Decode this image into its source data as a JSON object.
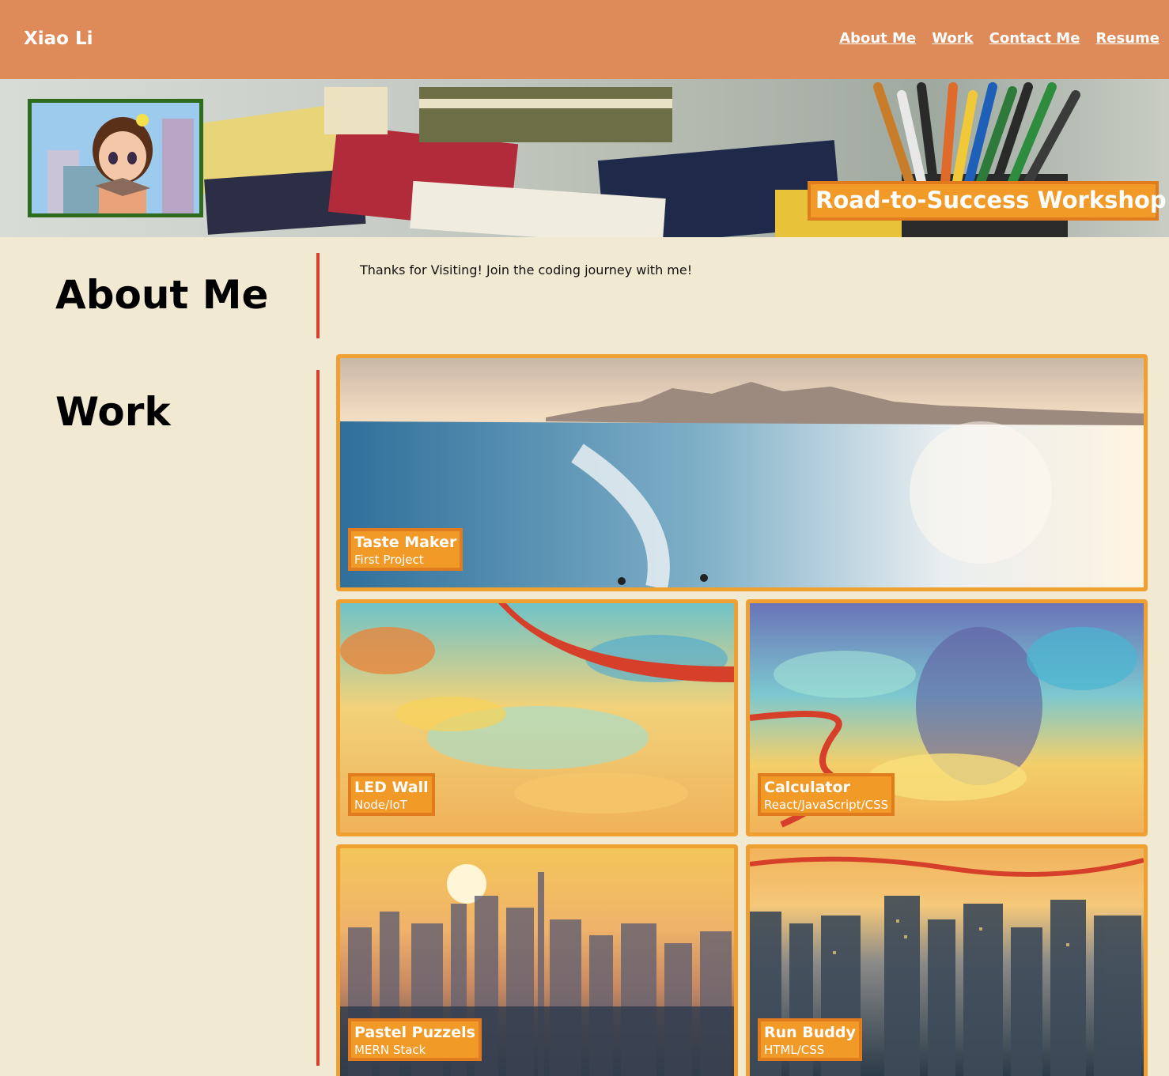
{
  "header": {
    "brand": "Xiao Li",
    "nav": [
      {
        "label": "About Me"
      },
      {
        "label": "Work"
      },
      {
        "label": "Contact Me"
      },
      {
        "label": "Resume"
      }
    ]
  },
  "hero": {
    "banner_text": "Road-to-Success Workshop"
  },
  "about": {
    "title": "About Me",
    "text": "Thanks for Visiting! Join the coding journey with me!"
  },
  "work": {
    "title": "Work",
    "projects": [
      {
        "title": "Taste Maker",
        "subtitle": "First Project"
      },
      {
        "title": "LED Wall",
        "subtitle": "Node/IoT"
      },
      {
        "title": "Calculator",
        "subtitle": "React/JavaScript/CSS"
      },
      {
        "title": "Pastel Puzzels",
        "subtitle": "MERN Stack"
      },
      {
        "title": "Run Buddy",
        "subtitle": "HTML/CSS"
      }
    ]
  },
  "colors": {
    "header_bg": "#de8b59",
    "page_bg": "#f2e9d3",
    "accent_orange": "#f29a28",
    "divider_red": "#d7402a",
    "avatar_border": "#2f6b1c"
  }
}
